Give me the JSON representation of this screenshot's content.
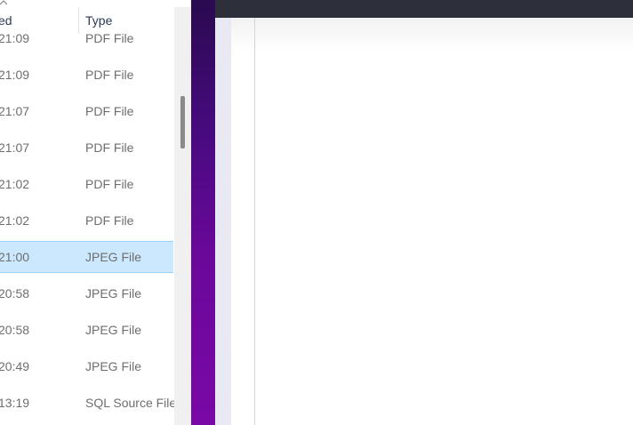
{
  "columns": {
    "date_modified": "ed",
    "type": "Type"
  },
  "rows": [
    {
      "time": "21:09",
      "type": "PDF File",
      "selected": false
    },
    {
      "time": "21:09",
      "type": "PDF File",
      "selected": false
    },
    {
      "time": "21:07",
      "type": "PDF File",
      "selected": false
    },
    {
      "time": "21:07",
      "type": "PDF File",
      "selected": false
    },
    {
      "time": "21:02",
      "type": "PDF File",
      "selected": false
    },
    {
      "time": "21:02",
      "type": "PDF File",
      "selected": false
    },
    {
      "time": "21:00",
      "type": "JPEG File",
      "selected": true
    },
    {
      "time": "20:58",
      "type": "JPEG File",
      "selected": false
    },
    {
      "time": "20:58",
      "type": "JPEG File",
      "selected": false
    },
    {
      "time": "20:49",
      "type": "JPEG File",
      "selected": false
    },
    {
      "time": "13:19",
      "type": "SQL Source File",
      "selected": false
    }
  ],
  "colors": {
    "selection_bg": "#cce8ff",
    "selection_border": "#99d1ff",
    "accent_purple": "#6a089a",
    "top_bar": "#2d2f3b"
  },
  "icons": {
    "sort": "chevron-up-icon"
  }
}
